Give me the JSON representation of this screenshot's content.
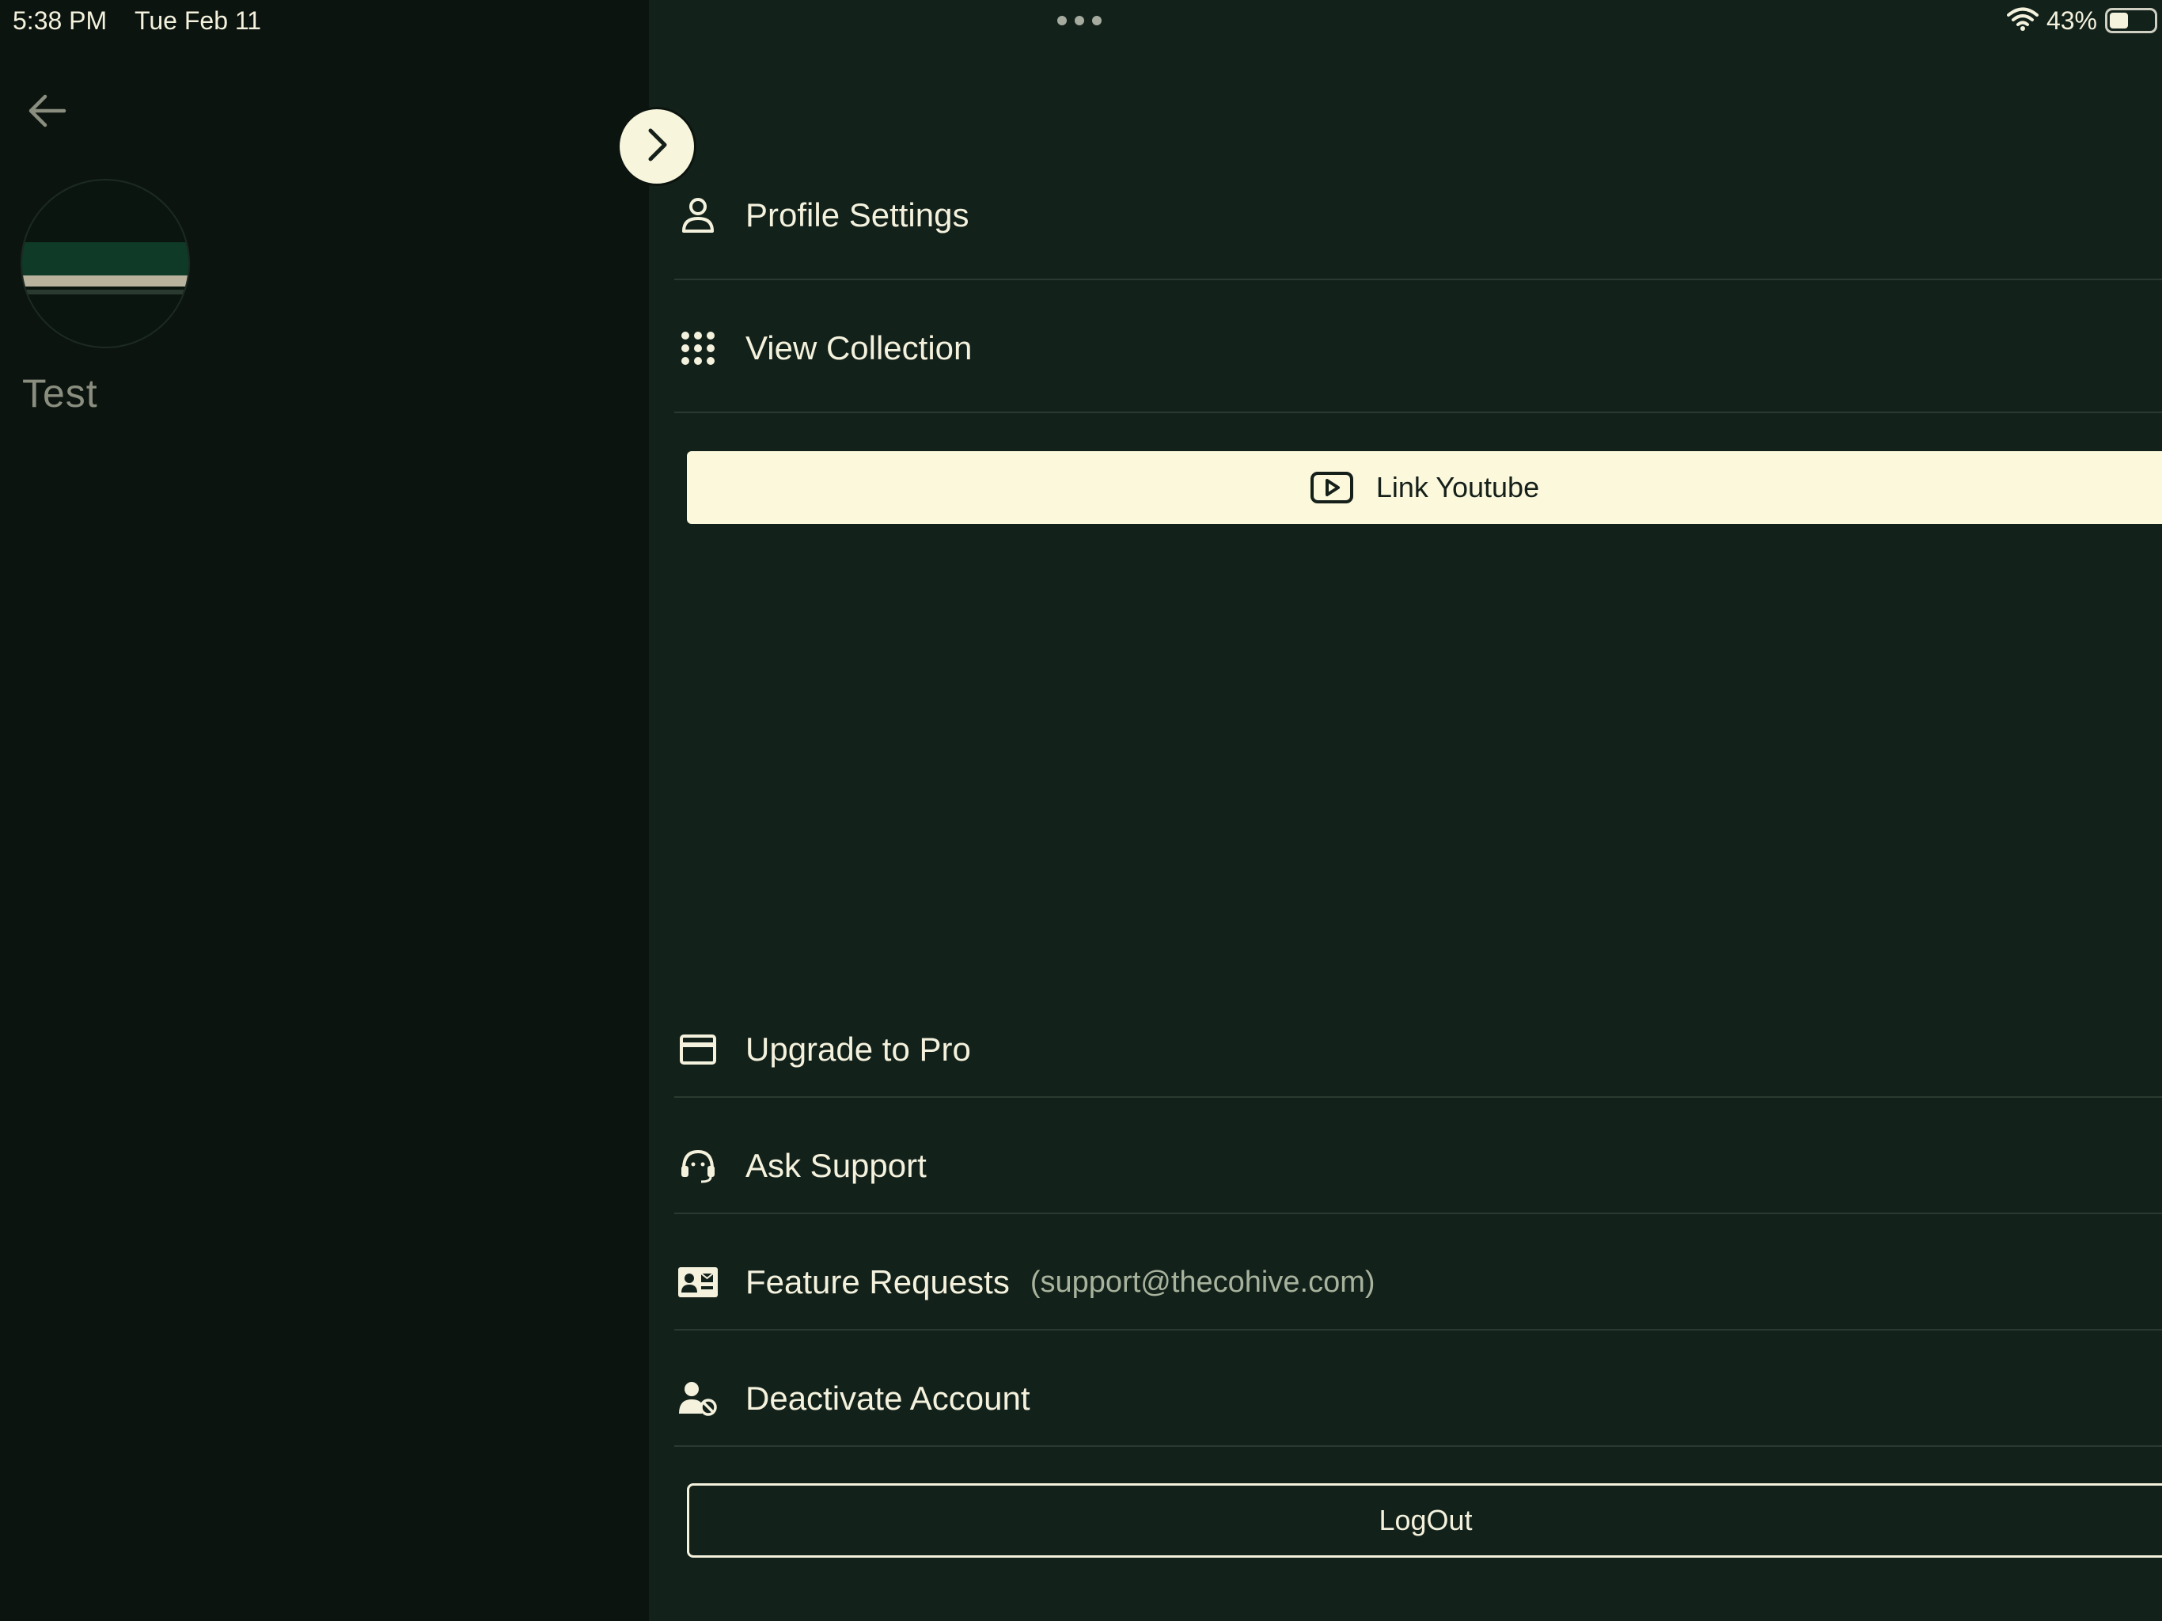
{
  "status_bar": {
    "time": "5:38 PM",
    "date": "Tue Feb 11",
    "battery_percent": "43%",
    "battery_level": 0.43,
    "icons": [
      "more-dots-icon",
      "wifi-icon",
      "battery-icon"
    ]
  },
  "sidebar": {
    "back_icon": "arrow-left-icon",
    "project_name": "Test"
  },
  "menu": {
    "collapse_icon": "chevron-right-icon",
    "profile_settings": "Profile Settings",
    "view_collection": "View Collection",
    "link_youtube": "Link Youtube",
    "upgrade_to_pro": "Upgrade to Pro",
    "ask_support": "Ask Support",
    "feature_requests": "Feature Requests",
    "feature_requests_email": "(support@thecohive.com)",
    "deactivate_account": "Deactivate Account",
    "logout": "LogOut"
  },
  "colors": {
    "background_left": "#0c1410",
    "background_panel": "#13211b",
    "accent_cream": "#fbf8dc",
    "text_primary": "#f4f2dd",
    "text_muted": "#a8b39d"
  }
}
